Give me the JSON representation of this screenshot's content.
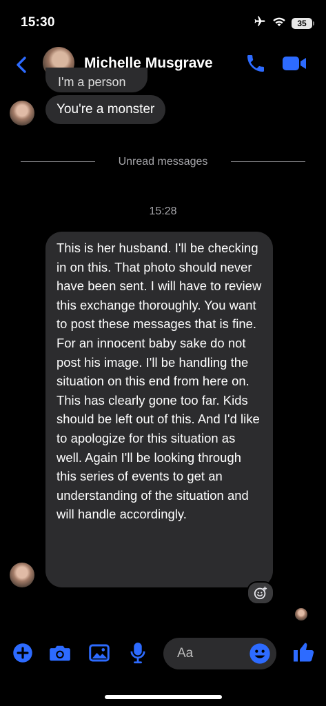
{
  "status_bar": {
    "time": "15:30",
    "battery": "35"
  },
  "header": {
    "contact_name": "Michelle Musgrave"
  },
  "messages": {
    "previous_partial": "I'm a person",
    "monster": "You're a monster",
    "divider_label": "Unread messages",
    "timestamp": "15:28",
    "long_message": "This is her husband. I'll be checking in on this. That photo should never have been sent. I will have to review this exchange thoroughly. You want to post these messages that is fine. For an innocent baby sake do not post his image. I'll be handling the situation on this end from here on. This has clearly gone too far. Kids should be left out of this. And I'd like to apologize for this situation as well. Again I'll be looking through this series of events to get an understanding of the situation and will handle accordingly."
  },
  "composer": {
    "placeholder": "Aa"
  },
  "colors": {
    "accent": "#2d6bff",
    "bubble": "#2c2c2e",
    "background": "#000000"
  },
  "icons": {
    "status": [
      "airplane-icon",
      "wifi-icon",
      "battery-icon"
    ],
    "header": [
      "back-icon",
      "phone-icon",
      "video-icon"
    ],
    "toolbar": [
      "plus-icon",
      "camera-icon",
      "gallery-icon",
      "mic-icon",
      "emoji-icon",
      "thumbs-up-icon"
    ]
  }
}
